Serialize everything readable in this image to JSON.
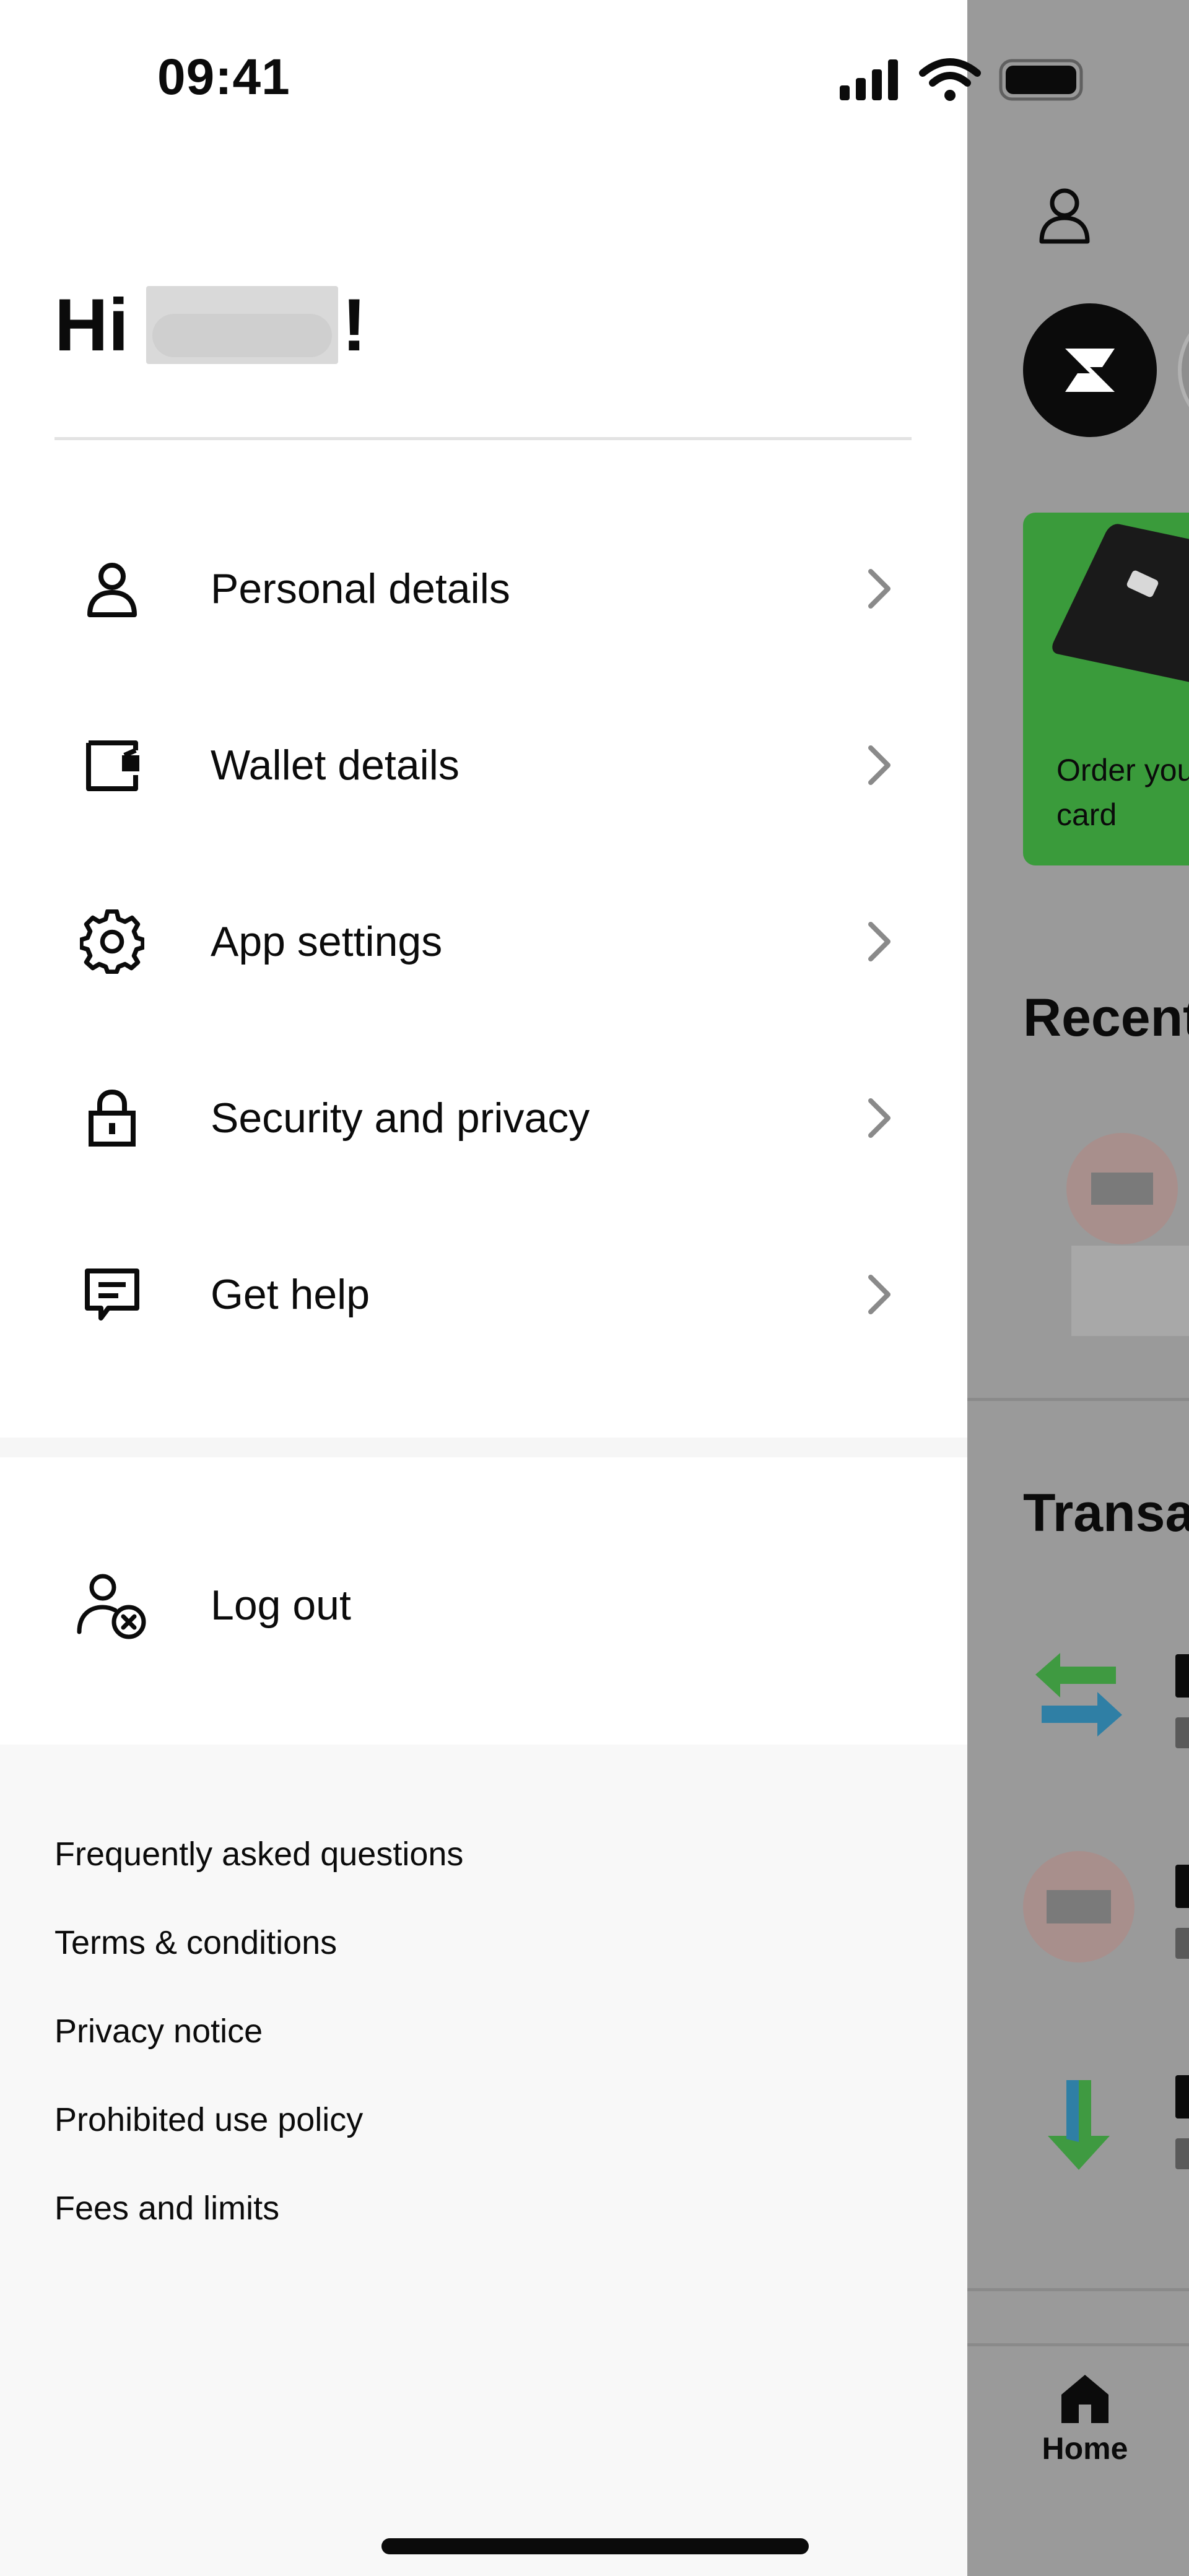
{
  "status_bar": {
    "time": "09:41"
  },
  "drawer": {
    "greeting_prefix": "Hi",
    "greeting_suffix": "!",
    "menu_items": [
      {
        "label": "Personal details",
        "icon": "person-icon"
      },
      {
        "label": "Wallet details",
        "icon": "wallet-icon"
      },
      {
        "label": "App settings",
        "icon": "gear-icon"
      },
      {
        "label": "Security and privacy",
        "icon": "lock-icon"
      },
      {
        "label": "Get help",
        "icon": "chat-icon"
      }
    ],
    "logout_label": "Log out",
    "footer_links": [
      "Frequently asked questions",
      "Terms & conditions",
      "Privacy notice",
      "Prohibited use policy",
      "Fees and limits"
    ]
  },
  "background_app": {
    "promo_text_line1": "Order you",
    "promo_text_line2": "card",
    "recent_title": "Recent",
    "transactions_title": "Transa",
    "tab_home_label": "Home"
  },
  "colors": {
    "promo_green": "#3a9b3b",
    "overlay_gray": "#9a9a9a",
    "text": "#0b0b0b"
  }
}
